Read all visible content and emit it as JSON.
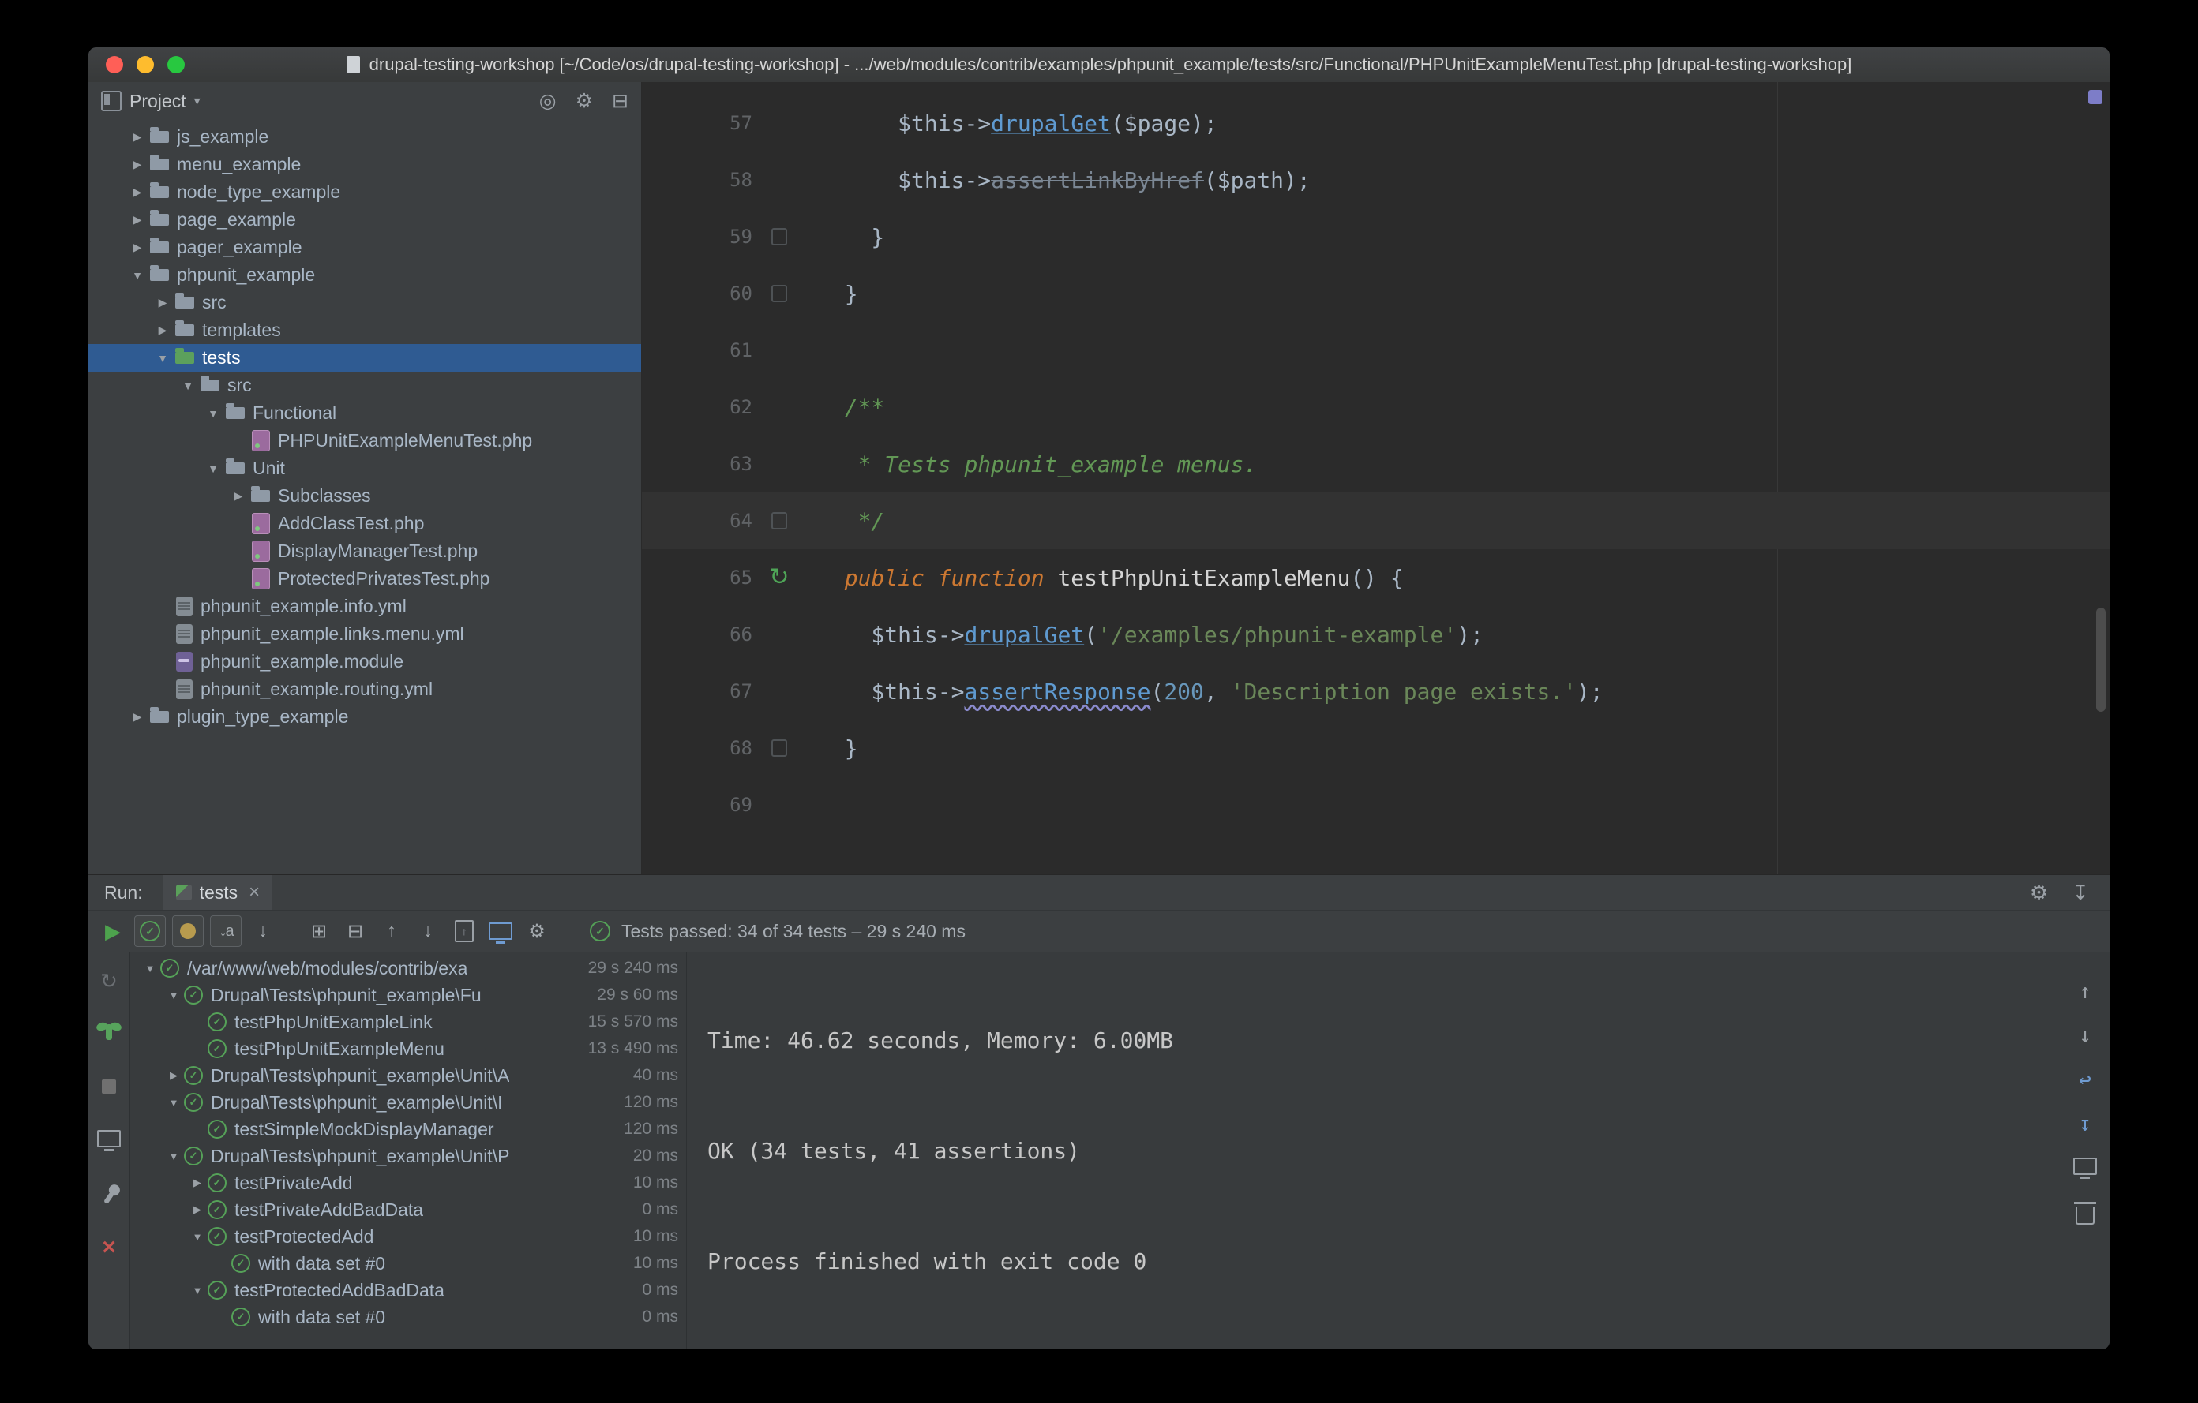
{
  "window": {
    "title": "drupal-testing-workshop [~/Code/os/drupal-testing-workshop] - .../web/modules/contrib/examples/phpunit_example/tests/src/Functional/PHPUnitExampleMenuTest.php [drupal-testing-workshop]"
  },
  "title_bar": {
    "lights": {
      "close": "#ff5f57",
      "minimize": "#febc2e",
      "zoom": "#28c840"
    }
  },
  "icons": {
    "chevron_expanded": "▼",
    "chevron_collapsed": "▶",
    "project_chevron": "▾",
    "gear": "⚙",
    "close": "×",
    "play": "▶",
    "check": "✓",
    "arrow_up": "↑",
    "arrow_down": "↓",
    "arrow_up_bar": "↥",
    "arrow_down_bar": "↧",
    "rerun": "↻",
    "soft_wrap": "↩",
    "locate": "◎",
    "collapse_all": "⊟",
    "expand_all": "⊞",
    "sort_alpha": "↓a",
    "sort_duration": "↓",
    "hide": "↧"
  },
  "project_panel": {
    "header": "Project",
    "tree": [
      {
        "label": "js_example",
        "type": "folder",
        "state": "collapsed",
        "indent": 1
      },
      {
        "label": "menu_example",
        "type": "folder",
        "state": "collapsed",
        "indent": 1
      },
      {
        "label": "node_type_example",
        "type": "folder",
        "state": "collapsed",
        "indent": 1
      },
      {
        "label": "page_example",
        "type": "folder",
        "state": "collapsed",
        "indent": 1
      },
      {
        "label": "pager_example",
        "type": "folder",
        "state": "collapsed",
        "indent": 1
      },
      {
        "label": "phpunit_example",
        "type": "folder",
        "state": "expanded",
        "indent": 1
      },
      {
        "label": "src",
        "type": "folder",
        "state": "collapsed",
        "indent": 2
      },
      {
        "label": "templates",
        "type": "folder",
        "state": "collapsed",
        "indent": 2
      },
      {
        "label": "tests",
        "type": "folder",
        "state": "expanded",
        "indent": 2,
        "selected": true,
        "test_root": true
      },
      {
        "label": "src",
        "type": "folder",
        "state": "expanded",
        "indent": 3
      },
      {
        "label": "Functional",
        "type": "folder",
        "state": "expanded",
        "indent": 4
      },
      {
        "label": "PHPUnitExampleMenuTest.php",
        "type": "php-test-file",
        "indent": 5
      },
      {
        "label": "Unit",
        "type": "folder",
        "state": "expanded",
        "indent": 4
      },
      {
        "label": "Subclasses",
        "type": "folder",
        "state": "collapsed",
        "indent": 5
      },
      {
        "label": "AddClassTest.php",
        "type": "php-test-file",
        "indent": 5
      },
      {
        "label": "DisplayManagerTest.php",
        "type": "php-test-file",
        "indent": 5
      },
      {
        "label": "ProtectedPrivatesTest.php",
        "type": "php-test-file",
        "indent": 5
      },
      {
        "label": "phpunit_example.info.yml",
        "type": "yaml-file",
        "indent": 2
      },
      {
        "label": "phpunit_example.links.menu.yml",
        "type": "yaml-file",
        "indent": 2
      },
      {
        "label": "phpunit_example.module",
        "type": "php-file",
        "indent": 2
      },
      {
        "label": "phpunit_example.routing.yml",
        "type": "yaml-file",
        "indent": 2
      },
      {
        "label": "plugin_type_example",
        "type": "folder",
        "state": "collapsed",
        "indent": 1
      }
    ]
  },
  "editor": {
    "lines": [
      {
        "num": 57,
        "segments": [
          {
            "t": "      "
          },
          {
            "t": "$this",
            "c": "var"
          },
          {
            "t": "->"
          },
          {
            "t": "drupalGet",
            "c": "method"
          },
          {
            "t": "("
          },
          {
            "t": "$page",
            "c": "var"
          },
          {
            "t": ");"
          }
        ]
      },
      {
        "num": 58,
        "segments": [
          {
            "t": "      "
          },
          {
            "t": "$this",
            "c": "var"
          },
          {
            "t": "->"
          },
          {
            "t": "assertLinkByHref",
            "c": "method strike"
          },
          {
            "t": "("
          },
          {
            "t": "$path",
            "c": "var"
          },
          {
            "t": ");"
          }
        ]
      },
      {
        "num": 59,
        "gutter": "marker",
        "segments": [
          {
            "t": "    }"
          }
        ]
      },
      {
        "num": 60,
        "gutter": "marker",
        "segments": [
          {
            "t": "  }"
          }
        ]
      },
      {
        "num": 61,
        "segments": []
      },
      {
        "num": 62,
        "segments": [
          {
            "t": "  "
          },
          {
            "t": "/**",
            "c": "comment"
          }
        ]
      },
      {
        "num": 63,
        "segments": [
          {
            "t": "   "
          },
          {
            "t": "* Tests phpunit_example menus.",
            "c": "comment"
          }
        ]
      },
      {
        "num": 64,
        "gutter": "marker",
        "caret": true,
        "segments": [
          {
            "t": "   "
          },
          {
            "t": "*/",
            "c": "comment"
          }
        ]
      },
      {
        "num": 65,
        "gutter": "run",
        "segments": [
          {
            "t": "  "
          },
          {
            "t": "public function",
            "c": "keyword"
          },
          {
            "t": " "
          },
          {
            "t": "testPhpUnitExampleMenu",
            "c": "decl"
          },
          {
            "t": "() {"
          }
        ]
      },
      {
        "num": 66,
        "segments": [
          {
            "t": "    "
          },
          {
            "t": "$this",
            "c": "var"
          },
          {
            "t": "->"
          },
          {
            "t": "drupalGet",
            "c": "method"
          },
          {
            "t": "("
          },
          {
            "t": "'/examples/phpunit-example'",
            "c": "string"
          },
          {
            "t": ");"
          }
        ]
      },
      {
        "num": 67,
        "segments": [
          {
            "t": "    "
          },
          {
            "t": "$this",
            "c": "var"
          },
          {
            "t": "->"
          },
          {
            "t": "assertResponse",
            "c": "method wavy"
          },
          {
            "t": "("
          },
          {
            "t": "200",
            "c": "number"
          },
          {
            "t": ", "
          },
          {
            "t": "'Description page exists.'",
            "c": "string"
          },
          {
            "t": ");"
          }
        ]
      },
      {
        "num": 68,
        "gutter": "marker",
        "segments": [
          {
            "t": "  }"
          }
        ]
      },
      {
        "num": 69,
        "segments": []
      }
    ]
  },
  "run_panel": {
    "label": "Run:",
    "tab": {
      "label": "tests"
    },
    "status": "Tests passed: 34 of 34 tests – 29 s 240 ms",
    "tree": [
      {
        "label": "/var/www/web/modules/contrib/exa",
        "duration": "29 s 240 ms",
        "indent": 0,
        "state": "expanded"
      },
      {
        "label": "Drupal\\Tests\\phpunit_example\\Fu",
        "duration": "29 s 60 ms",
        "indent": 1,
        "state": "expanded"
      },
      {
        "label": "testPhpUnitExampleLink",
        "duration": "15 s 570 ms",
        "indent": 2
      },
      {
        "label": "testPhpUnitExampleMenu",
        "duration": "13 s 490 ms",
        "indent": 2
      },
      {
        "label": "Drupal\\Tests\\phpunit_example\\Unit\\A",
        "duration": "40 ms",
        "indent": 1,
        "state": "collapsed"
      },
      {
        "label": "Drupal\\Tests\\phpunit_example\\Unit\\I",
        "duration": "120 ms",
        "indent": 1,
        "state": "expanded"
      },
      {
        "label": "testSimpleMockDisplayManager",
        "duration": "120 ms",
        "indent": 2
      },
      {
        "label": "Drupal\\Tests\\phpunit_example\\Unit\\P",
        "duration": "20 ms",
        "indent": 1,
        "state": "expanded"
      },
      {
        "label": "testPrivateAdd",
        "duration": "10 ms",
        "indent": 2,
        "state": "collapsed"
      },
      {
        "label": "testPrivateAddBadData",
        "duration": "0 ms",
        "indent": 2,
        "state": "collapsed"
      },
      {
        "label": "testProtectedAdd",
        "duration": "10 ms",
        "indent": 2,
        "state": "expanded"
      },
      {
        "label": "with data set #0",
        "duration": "10 ms",
        "indent": 3
      },
      {
        "label": "testProtectedAddBadData",
        "duration": "0 ms",
        "indent": 2,
        "state": "expanded"
      },
      {
        "label": "with data set #0",
        "duration": "0 ms",
        "indent": 3
      }
    ],
    "console": [
      "Time: 46.62 seconds, Memory: 6.00MB",
      "OK (34 tests, 41 assertions)",
      "Process finished with exit code 0"
    ]
  }
}
